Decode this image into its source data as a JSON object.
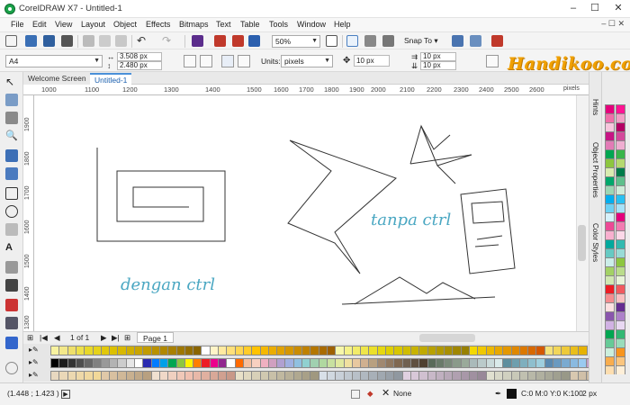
{
  "window": {
    "title": "CorelDRAW X7 - Untitled-1",
    "minimize": "–",
    "maximize": "☐",
    "close": "✕"
  },
  "menu": {
    "items": [
      "File",
      "Edit",
      "View",
      "Layout",
      "Object",
      "Effects",
      "Bitmaps",
      "Text",
      "Table",
      "Tools",
      "Window",
      "Help"
    ],
    "doc_controls": "– ☐ ✕"
  },
  "toolbar": {
    "zoom": "50%",
    "snap_to": "Snap To"
  },
  "property_bar": {
    "page_size": "A4",
    "width": "3.508 px",
    "height": "2.480 px",
    "units_label": "Units:",
    "units": "pixels",
    "nudge": "10 px",
    "dup_x": "10 px",
    "dup_y": "10 px"
  },
  "watermark": "Handikoo.com",
  "tabs": {
    "welcome": "Welcome Screen",
    "document": "Untitled-1"
  },
  "ruler": {
    "h_labels": [
      "1000",
      "1100",
      "1200",
      "1300",
      "1400",
      "1500",
      "1600",
      "1700",
      "1800",
      "1900",
      "2000",
      "2100",
      "2200",
      "2300",
      "2400",
      "2500",
      "2600"
    ],
    "units": "pixels",
    "v_labels": [
      "1900",
      "1800",
      "1700",
      "1600",
      "1500",
      "1400",
      "1300"
    ]
  },
  "canvas": {
    "label_ctrl": "dengan ctrl",
    "label_no_ctrl": "tanpa ctrl"
  },
  "page_nav": {
    "count": "1 of 1",
    "page_tab": "Page 1"
  },
  "dockers": {
    "tabs": [
      "Hints",
      "Object Properties",
      "Color Styles"
    ]
  },
  "status": {
    "coords": "(1.448 ; 1.423 )",
    "fill": "None",
    "outline": "C:0 M:0 Y:0 K:100",
    "outline_width": "2 px"
  },
  "palette": {
    "row1": [
      "#f7f2a0",
      "#f3e88a",
      "#efe06b",
      "#ede04a",
      "#e8d82a",
      "#e6d21a",
      "#e2c80a",
      "#dcc000",
      "#d8b800",
      "#cfae00",
      "#c9a500",
      "#c19b00",
      "#b99100",
      "#b08800",
      "#a88000",
      "#9e7700",
      "#946e00",
      "#8a6500",
      "#ffffff",
      "#fff4c8",
      "#ffeaa0",
      "#ffe07a",
      "#ffd652",
      "#ffcc2a",
      "#ffc300",
      "#f5b800",
      "#ebad00",
      "#e0a200",
      "#d59700",
      "#ca8c00",
      "#bf8100",
      "#b47600",
      "#a96b00",
      "#9e6000",
      "#f7f7aa",
      "#f5f28a",
      "#f2ec6a",
      "#efe64a",
      "#ece02a",
      "#e6d810",
      "#dfcf00",
      "#d8c600",
      "#d0bd00",
      "#c8b300",
      "#c0aa00",
      "#b8a100",
      "#b09800",
      "#a88f00",
      "#a08600",
      "#988000",
      "#f4d800",
      "#f0c800",
      "#ecb800",
      "#e8a800",
      "#e49800",
      "#e08800",
      "#dc7800",
      "#d86800",
      "#d45800",
      "#f6e27a",
      "#f2d65a",
      "#eeca3a",
      "#eabe1a",
      "#e6b200"
    ],
    "row2": [
      "#000000",
      "#1a1a1a",
      "#333333",
      "#4d4d4d",
      "#666666",
      "#808080",
      "#999999",
      "#b3b3b3",
      "#cccccc",
      "#e6e6e6",
      "#ffffff",
      "#2b2bb0",
      "#007bff",
      "#00a0e9",
      "#00a651",
      "#8dc63f",
      "#fff200",
      "#ff7f00",
      "#ed1c24",
      "#ec008c",
      "#92278f",
      "#ffffff",
      "#ff6a00",
      "#f5c0a0",
      "#f8d0c0",
      "#f0b0c0",
      "#d0a0c0",
      "#b0a0d0",
      "#a0b0e0",
      "#90c0e0",
      "#90d0d0",
      "#a0d0b0",
      "#b0d8a0",
      "#c8e0a0",
      "#e0e8a0",
      "#f0e0a0",
      "#e8c8a0",
      "#d0b090",
      "#b8a080",
      "#a08870",
      "#907860",
      "#806850",
      "#706050",
      "#605040",
      "#504030",
      "#5a6a5a",
      "#6a7a6a",
      "#7a8a7a",
      "#8a9a8a",
      "#9aaa9a",
      "#aababa",
      "#bacaca",
      "#cadada",
      "#daeaea",
      "#5e8f9e",
      "#6e9fae",
      "#7eafbe",
      "#8ebfce",
      "#9ecfde",
      "#5a8ab0",
      "#6a9ac0",
      "#7aaad0",
      "#8abae0",
      "#9acaf0",
      "#c0a0c8"
    ],
    "row3": [
      "#e8d8c0",
      "#ead8b8",
      "#ecd8b0",
      "#eed8a8",
      "#f0d8a0",
      "#f2d898",
      "#e0c8a8",
      "#d8c0a0",
      "#d0b898",
      "#c8b090",
      "#c0a888",
      "#b8a080",
      "#f0e0d0",
      "#f0d8c8",
      "#f0d0c0",
      "#f0c8b8",
      "#f0c0b0",
      "#e8b8a8",
      "#e0b0a0",
      "#d8a898",
      "#d0a090",
      "#c89888",
      "#e8e0c8",
      "#e0d8c0",
      "#d8d0b8",
      "#d0c8b0",
      "#c8c0a8",
      "#c0b8a0",
      "#b8b098",
      "#b0a890",
      "#a8a088",
      "#a09880",
      "#d8e0e8",
      "#d0d8e0",
      "#c8d0d8",
      "#c0c8d0",
      "#b8c0c8",
      "#b0b8c0",
      "#a8b0b8",
      "#a0a8b0",
      "#98a0a8",
      "#9098a0",
      "#e0d0e0",
      "#d8c8d8",
      "#d0c0d0",
      "#c8b8c8",
      "#c0b0c0",
      "#b8a8b8",
      "#b0a0b0",
      "#a898a8",
      "#a090a0",
      "#988898",
      "#e0e0d0",
      "#d8d8c8",
      "#d0d0c0",
      "#c8c8b8",
      "#c0c0b0",
      "#b8b8a8",
      "#b0b0a0",
      "#a8a898",
      "#a0a090",
      "#989888",
      "#d8c8b0",
      "#d0c0a8",
      "#c8b8a0"
    ],
    "right": [
      "#e4007c",
      "#ff1493",
      "#f06ea9",
      "#f29fc5",
      "#f7c6dd",
      "#b40064",
      "#c71585",
      "#d44a9c",
      "#e27bb6",
      "#efaed1",
      "#00a651",
      "#39b54a",
      "#8dc63f",
      "#b5d96f",
      "#d9ecb0",
      "#007c4a",
      "#00a76b",
      "#5fbf8c",
      "#9dd6b4",
      "#cfecd9",
      "#00aeef",
      "#29c0f1",
      "#6dd1f4",
      "#a7e2f8",
      "#d6f1fb",
      "#e4007c",
      "#ec4a96",
      "#f27db2",
      "#f8b0cf",
      "#fcd8e8",
      "#00a99d",
      "#33bab0",
      "#66cac3",
      "#99dbd6",
      "#cceee9",
      "#8dc63f",
      "#a3d165",
      "#badc8b",
      "#d1e8b2",
      "#e8f4d8",
      "#ed1c24",
      "#f15a5f",
      "#f58c8f",
      "#f9bfc1",
      "#fce0e1",
      "#662d91",
      "#8a56ad",
      "#ad82c9",
      "#d1b2e4",
      "#e8d8f2",
      "#00a651",
      "#33b874",
      "#66ca97",
      "#99dcba",
      "#ccefdd",
      "#f7941d",
      "#f9ad4d",
      "#fbc57e",
      "#fddeb0",
      "#feefd8"
    ]
  }
}
